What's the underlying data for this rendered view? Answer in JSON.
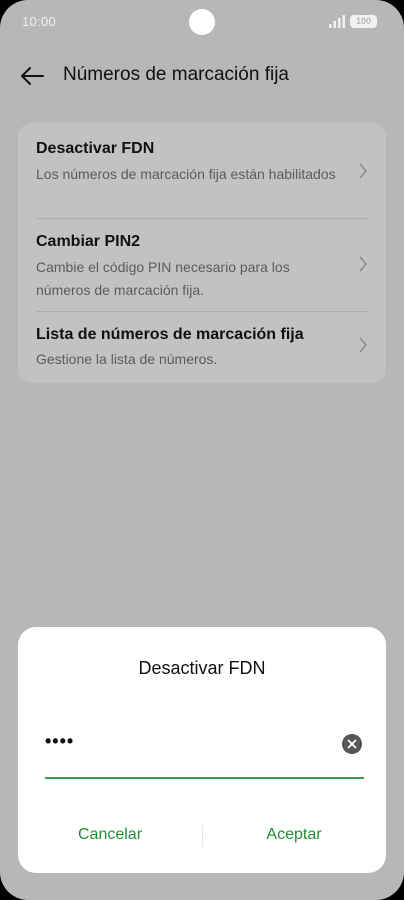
{
  "status_bar": {
    "time": "10:00",
    "battery": "100",
    "icons": [
      "signal-icon",
      "battery-icon"
    ]
  },
  "header": {
    "back_icon": "back-arrow-icon",
    "title": "Números de marcación fija"
  },
  "settings": {
    "items": [
      {
        "title": "Desactivar FDN",
        "description": "Los números de marcación fija están habilitados"
      },
      {
        "title": "Cambiar PIN2",
        "description": "Cambie el código PIN necesario para los números de marcación fija."
      },
      {
        "title": "Lista de números de marcación fija",
        "description": "Gestione la lista de números."
      }
    ]
  },
  "dialog": {
    "title": "Desactivar FDN",
    "input_value": "••••",
    "clear_icon": "clear-icon",
    "cancel_label": "Cancelar",
    "accept_label": "Aceptar"
  },
  "colors": {
    "accent": "#1f8f36",
    "background": "#b7b7b9",
    "card": "#c2c2c4",
    "dialog": "#ffffff"
  }
}
